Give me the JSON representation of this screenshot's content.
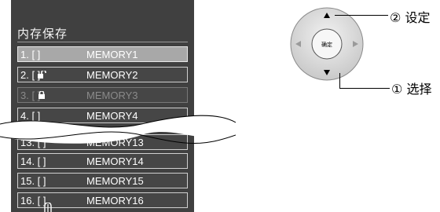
{
  "osd": {
    "title": "内存保存",
    "rows": [
      {
        "num": "1. [    ]",
        "name": "MEMORY1",
        "state": "selected"
      },
      {
        "num": "2. [    ]",
        "name": "MEMORY2",
        "state": "unlocked"
      },
      {
        "num": "3. [    ]",
        "name": "MEMORY3",
        "state": "locked-disabled"
      },
      {
        "num": "4. [    ]",
        "name": "MEMORY4",
        "state": "normal"
      },
      {
        "num": "13. [    ]",
        "name": "MEMORY13",
        "state": "normal"
      },
      {
        "num": "14. [    ]",
        "name": "MEMORY14",
        "state": "normal"
      },
      {
        "num": "15. [    ]",
        "name": "MEMORY15",
        "state": "normal"
      },
      {
        "num": "16. [    ]",
        "name": "MEMORY16",
        "state": "cursor"
      }
    ],
    "colors": {
      "panel": "#404040",
      "row_selected": "#a8a8a8",
      "text": "#ffffff",
      "text_disabled": "#8a8a8a"
    }
  },
  "remote": {
    "center_label": "确定",
    "icons": [
      "arrow-up-icon",
      "arrow-down-icon",
      "arrow-left-icon",
      "arrow-right-icon"
    ]
  },
  "callouts": {
    "set": {
      "marker": "②",
      "label": "设定"
    },
    "select": {
      "marker": "①",
      "label": "选择"
    }
  }
}
